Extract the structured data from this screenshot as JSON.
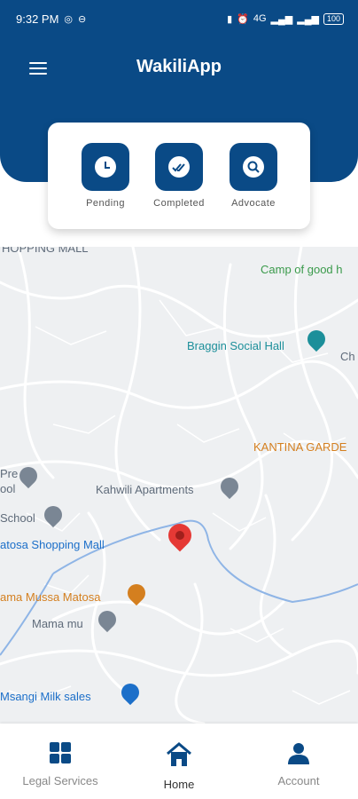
{
  "status_bar": {
    "time": "9:32 PM",
    "network": "4G",
    "battery": "100"
  },
  "header": {
    "title": "WakiliApp"
  },
  "quick_actions": [
    {
      "label": "Pending",
      "icon": "clock-icon"
    },
    {
      "label": "Completed",
      "icon": "double-check-icon"
    },
    {
      "label": "Advocate",
      "icon": "search-icon"
    }
  ],
  "map": {
    "places": [
      {
        "label": "HOPPING MALL",
        "color": "#5f6b7a"
      },
      {
        "label": "Camp of good h",
        "color": "#3a9a4b"
      },
      {
        "label": "Braggin Social Hall",
        "color": "#1c8f9a"
      },
      {
        "label": "Ch",
        "color": "#5f6b7a"
      },
      {
        "label": "KANTINA GARDE",
        "color": "#d47f1f"
      },
      {
        "label": "Pre",
        "color": "#5f6b7a"
      },
      {
        "label": "ool",
        "color": "#5f6b7a"
      },
      {
        "label": "Kahwili Apartments",
        "color": "#5f6b7a"
      },
      {
        "label": "School",
        "color": "#5f6b7a"
      },
      {
        "label": "atosa Shopping Mall",
        "color": "#1c6fc9"
      },
      {
        "label": "ama Mussa Matosa",
        "color": "#d47f1f"
      },
      {
        "label": "Mama mu",
        "color": "#5f6b7a"
      },
      {
        "label": "Msangi Milk sales",
        "color": "#1c6fc9"
      }
    ]
  },
  "nav": {
    "items": [
      {
        "label": "Legal Services",
        "icon": "grid-icon"
      },
      {
        "label": "Home",
        "icon": "home-icon"
      },
      {
        "label": "Account",
        "icon": "person-icon"
      }
    ]
  },
  "colors": {
    "primary": "#0a4a86",
    "pin": "#e53935"
  }
}
